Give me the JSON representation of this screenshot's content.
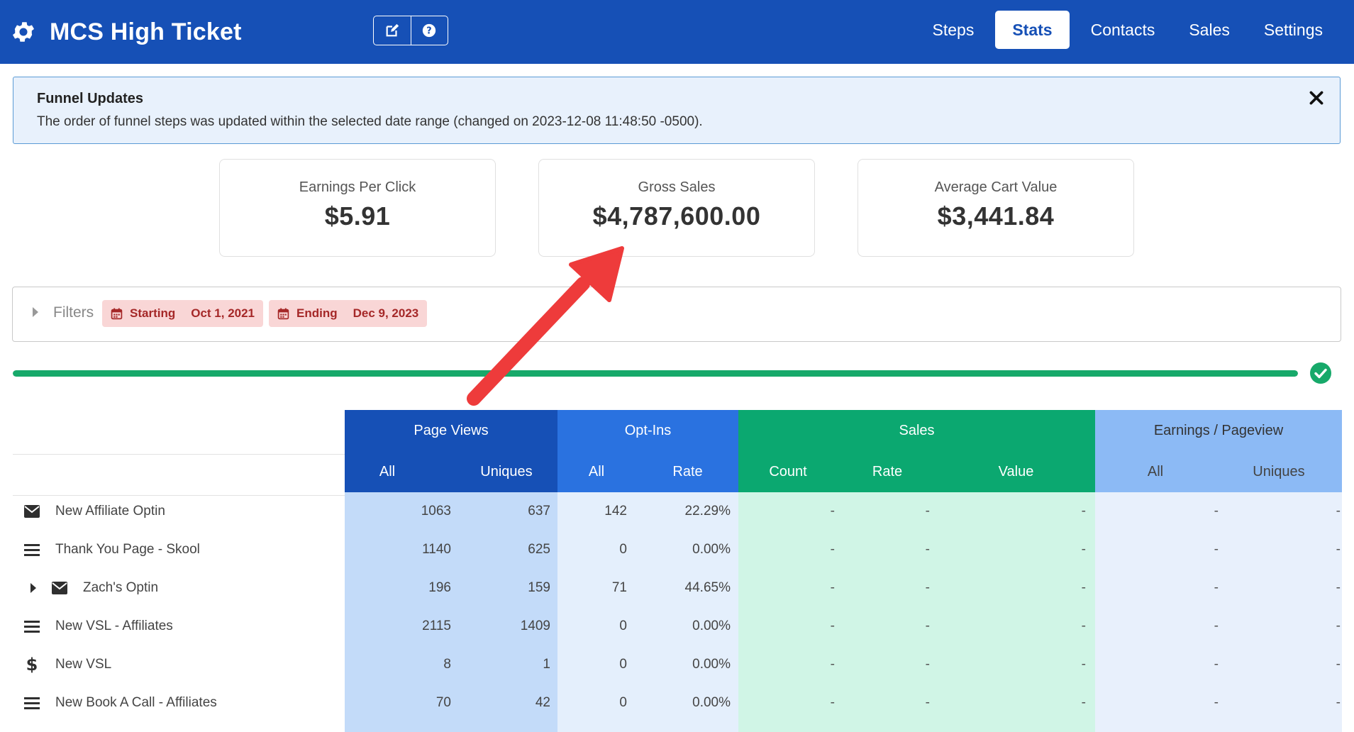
{
  "header": {
    "app_title": "MCS High Ticket",
    "nav": [
      {
        "label": "Steps",
        "active": false
      },
      {
        "label": "Stats",
        "active": true
      },
      {
        "label": "Contacts",
        "active": false
      },
      {
        "label": "Sales",
        "active": false
      },
      {
        "label": "Settings",
        "active": false
      }
    ]
  },
  "alert": {
    "title": "Funnel Updates",
    "message": "The order of funnel steps was updated within the selected date range (changed on 2023-12-08 11:48:50 -0500)."
  },
  "kpis": [
    {
      "label": "Earnings Per Click",
      "value": "$5.91"
    },
    {
      "label": "Gross Sales",
      "value": "$4,787,600.00"
    },
    {
      "label": "Average Cart Value",
      "value": "$3,441.84"
    }
  ],
  "filters": {
    "label": "Filters",
    "starting_key": "Starting",
    "starting_value": "Oct 1, 2021",
    "ending_key": "Ending",
    "ending_value": "Dec 9, 2023"
  },
  "progress": {
    "percent": 100,
    "color": "#17a96a"
  },
  "table": {
    "groups": {
      "page_views": "Page Views",
      "opt_ins": "Opt-Ins",
      "sales": "Sales",
      "earnings": "Earnings / Pageview"
    },
    "subheaders": {
      "pv_all": "All",
      "pv_uniques": "Uniques",
      "oi_all": "All",
      "oi_rate": "Rate",
      "s_count": "Count",
      "s_rate": "Rate",
      "s_value": "Value",
      "e_all": "All",
      "e_uniques": "Uniques"
    },
    "rows": [
      {
        "icon": "envelope-icon",
        "expandable": false,
        "name": "New Affiliate Optin",
        "pv_all": "1063",
        "pv_uniques": "637",
        "oi_all": "142",
        "oi_rate": "22.29%",
        "s_count": "-",
        "s_rate": "-",
        "s_value": "-",
        "e_all": "-",
        "e_uniques": "-"
      },
      {
        "icon": "list-icon",
        "expandable": false,
        "name": "Thank You Page - Skool",
        "pv_all": "1140",
        "pv_uniques": "625",
        "oi_all": "0",
        "oi_rate": "0.00%",
        "s_count": "-",
        "s_rate": "-",
        "s_value": "-",
        "e_all": "-",
        "e_uniques": "-"
      },
      {
        "icon": "envelope-icon",
        "expandable": true,
        "name": "Zach's Optin",
        "pv_all": "196",
        "pv_uniques": "159",
        "oi_all": "71",
        "oi_rate": "44.65%",
        "s_count": "-",
        "s_rate": "-",
        "s_value": "-",
        "e_all": "-",
        "e_uniques": "-"
      },
      {
        "icon": "list-icon",
        "expandable": false,
        "name": "New VSL - Affiliates",
        "pv_all": "2115",
        "pv_uniques": "1409",
        "oi_all": "0",
        "oi_rate": "0.00%",
        "s_count": "-",
        "s_rate": "-",
        "s_value": "-",
        "e_all": "-",
        "e_uniques": "-"
      },
      {
        "icon": "dollar-icon",
        "expandable": false,
        "name": "New VSL",
        "pv_all": "8",
        "pv_uniques": "1",
        "oi_all": "0",
        "oi_rate": "0.00%",
        "s_count": "-",
        "s_rate": "-",
        "s_value": "-",
        "e_all": "-",
        "e_uniques": "-"
      },
      {
        "icon": "list-icon",
        "expandable": false,
        "name": "New Book A Call - Affiliates",
        "pv_all": "70",
        "pv_uniques": "42",
        "oi_all": "0",
        "oi_rate": "0.00%",
        "s_count": "-",
        "s_rate": "-",
        "s_value": "-",
        "e_all": "-",
        "e_uniques": "-"
      }
    ]
  },
  "colors": {
    "header": "#1650b6",
    "page_views_head": "#1650b6",
    "opt_ins_head": "#2a72e0",
    "sales_head": "#0ba870",
    "earnings_head": "#8cbaf5",
    "annotation_arrow": "#ee3b3b"
  },
  "icons": [
    "gear-icon",
    "edit-icon",
    "help-icon",
    "close-icon",
    "calendar-icon",
    "check-circle-icon",
    "envelope-icon",
    "list-icon",
    "dollar-icon",
    "caret-right-icon"
  ]
}
